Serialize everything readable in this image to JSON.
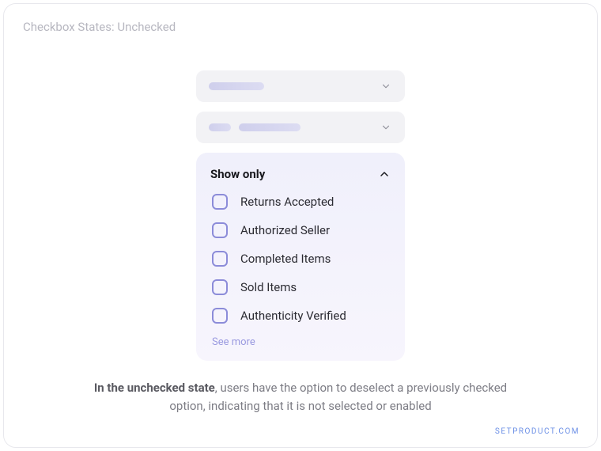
{
  "page_title": "Checkbox States: Unchecked",
  "collapsed_rows": [
    {
      "placeholders": [
        "w1"
      ]
    },
    {
      "placeholders": [
        "w2",
        "w3"
      ]
    }
  ],
  "panel": {
    "title": "Show only",
    "options": [
      {
        "label": "Returns Accepted"
      },
      {
        "label": "Authorized Seller"
      },
      {
        "label": "Completed Items"
      },
      {
        "label": "Sold Items"
      },
      {
        "label": "Authenticity Verified"
      }
    ],
    "see_more": "See more"
  },
  "caption": {
    "bold": "In the unchecked state",
    "rest": ", users have the option to deselect a previously checked option, indicating that it is not selected or enabled"
  },
  "watermark": "SETPRODUCT.COM"
}
